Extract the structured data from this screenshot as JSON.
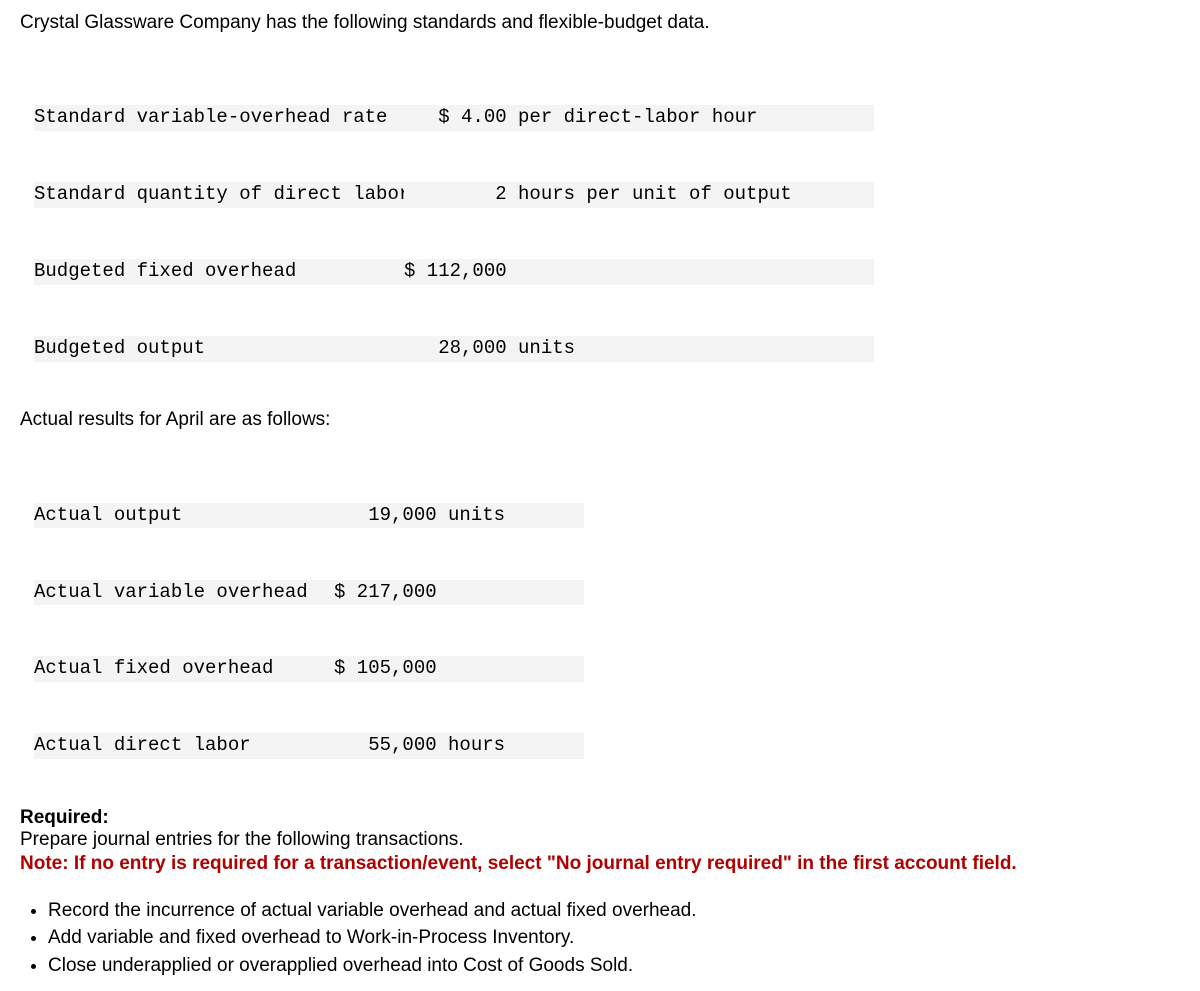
{
  "intro": "Crystal Glassware Company has the following standards and flexible-budget data.",
  "standards": {
    "rows": [
      {
        "label": "Standard variable-overhead rate",
        "value": "   $ 4.00 per direct-labor hour"
      },
      {
        "label": "Standard quantity of direct labor",
        "value": "        2 hours per unit of output"
      },
      {
        "label": "Budgeted fixed overhead",
        "value": "$ 112,000"
      },
      {
        "label": "Budgeted output",
        "value": "   28,000 units"
      }
    ]
  },
  "actual_heading": "Actual results for April are as follows:",
  "actuals": {
    "rows": [
      {
        "label": "Actual output",
        "value": "   19,000 units"
      },
      {
        "label": "Actual variable overhead",
        "value": "$ 217,000"
      },
      {
        "label": "Actual fixed overhead",
        "value": "$ 105,000"
      },
      {
        "label": "Actual direct labor",
        "value": "   55,000 hours"
      }
    ]
  },
  "required": {
    "label": "Required:",
    "prepare": "Prepare journal entries for the following transactions.",
    "note": "Note: If no entry is required for a transaction/event, select \"No journal entry required\" in the first account field."
  },
  "bullets": [
    "Record the incurrence of actual variable overhead and actual fixed overhead.",
    "Add variable and fixed overhead to Work-in-Process Inventory.",
    "Close underapplied or overapplied overhead into Cost of Goods Sold."
  ]
}
